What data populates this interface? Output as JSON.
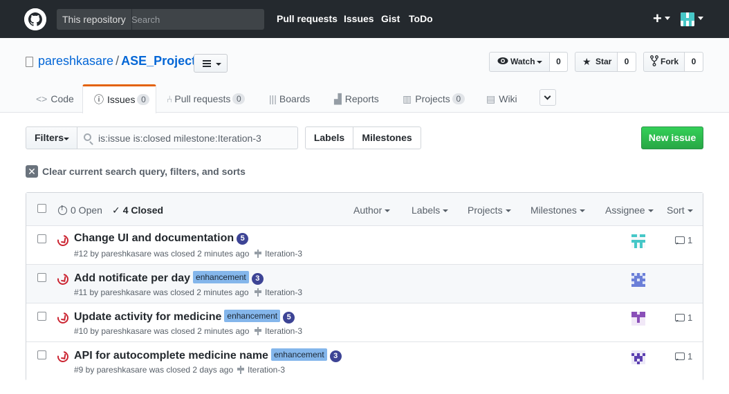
{
  "header": {
    "scope_label": "This repository",
    "search_placeholder": "Search",
    "nav": [
      "Pull requests",
      "Issues",
      "Gist",
      "ToDo"
    ],
    "plus_label": "+"
  },
  "repo": {
    "owner": "pareshkasare",
    "separator": "/",
    "name": "ASE_Project",
    "watch_label": "Watch",
    "watch_count": "0",
    "star_label": "Star",
    "star_count": "0",
    "fork_label": "Fork",
    "fork_count": "0"
  },
  "tabs": [
    {
      "label": "Code",
      "icon": "code-icon"
    },
    {
      "label": "Issues",
      "count": "0",
      "icon": "issue-icon"
    },
    {
      "label": "Pull requests",
      "count": "0",
      "icon": "pull-request-icon"
    },
    {
      "label": "Boards",
      "icon": "boards-icon"
    },
    {
      "label": "Reports",
      "icon": "graph-icon"
    },
    {
      "label": "Projects",
      "count": "0",
      "icon": "project-icon"
    },
    {
      "label": "Wiki",
      "icon": "book-icon"
    }
  ],
  "filters": {
    "button_label": "Filters",
    "query": "is:issue is:closed milestone:Iteration-3",
    "labels_label": "Labels",
    "milestones_label": "Milestones",
    "new_issue_label": "New issue",
    "clear_label": "Clear current search query, filters, and sorts"
  },
  "list_header": {
    "open_label": "0 Open",
    "closed_label": "4 Closed",
    "check_glyph": "✓",
    "dropdowns": [
      "Author",
      "Labels",
      "Projects",
      "Milestones",
      "Assignee",
      "Sort"
    ]
  },
  "issues": [
    {
      "title": "Change UI and documentation",
      "label": "",
      "badge": "5",
      "meta": "#12 by pareshkasare was closed 2 minutes ago",
      "milestone": "Iteration-3",
      "comments": "1",
      "avatar_color": "#46c7c7"
    },
    {
      "title": "Add notificate per day",
      "label": "enhancement",
      "badge": "3",
      "meta": "#11 by pareshkasare was closed 2 minutes ago",
      "milestone": "Iteration-3",
      "comments": "",
      "avatar_color": "#6b7fd8"
    },
    {
      "title": "Update activity for medicine",
      "label": "enhancement",
      "badge": "5",
      "meta": "#10 by pareshkasare was closed 2 minutes ago",
      "milestone": "Iteration-3",
      "comments": "1",
      "avatar_color": "#8a4fb8"
    },
    {
      "title": "API for autocomplete medicine name",
      "label": "enhancement",
      "badge": "3",
      "meta": "#9 by pareshkasare was closed 2 days ago",
      "milestone": "Iteration-3",
      "comments": "1",
      "avatar_color": "#5b3fb0"
    }
  ],
  "colors": {
    "header_bg": "#24292e",
    "link": "#0366d6",
    "tab_accent": "#e36209",
    "closed_icon": "#cb2431",
    "new_issue_green": "#28a745",
    "enhancement_label": "#84b6eb",
    "badge": "#3d4495"
  }
}
